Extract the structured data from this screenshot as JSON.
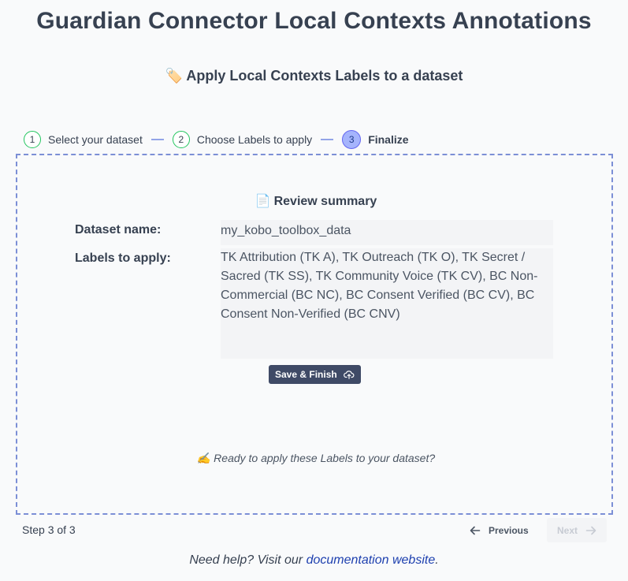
{
  "header": {
    "title": "Guardian Connector Local Contexts Annotations",
    "subtitle_icon": "🏷️",
    "subtitle": "Apply Local Contexts Labels to a dataset"
  },
  "stepper": {
    "steps": [
      {
        "number": "1",
        "label": "Select your dataset",
        "state": "complete"
      },
      {
        "number": "2",
        "label": "Choose Labels to apply",
        "state": "complete"
      },
      {
        "number": "3",
        "label": "Finalize",
        "state": "active"
      }
    ]
  },
  "review": {
    "icon": "📄",
    "title": "Review summary",
    "dataset_label": "Dataset name:",
    "dataset_value": "my_kobo_toolbox_data",
    "labels_label": "Labels to apply:",
    "labels_value": "TK Attribution (TK A), TK Outreach (TK O), TK Secret / Sacred (TK SS), TK Community Voice (TK CV), BC Non-Commercial (BC NC), BC Consent Verified (BC CV), BC Consent Non-Verified (BC CNV)",
    "save_button": "Save & Finish",
    "save_icon": "cloud-upload-icon",
    "ready_icon": "✍️",
    "ready_text": "Ready to apply these Labels to your dataset?"
  },
  "footer": {
    "step_count": "Step 3 of 3",
    "previous": "Previous",
    "next": "Next",
    "help_prefix": "Need help? Visit our ",
    "help_link": "documentation website",
    "help_suffix": "."
  },
  "colors": {
    "accent": "#6366f1",
    "complete": "#22c55e",
    "button_dark": "#3f4a66",
    "link": "#1e40af"
  }
}
